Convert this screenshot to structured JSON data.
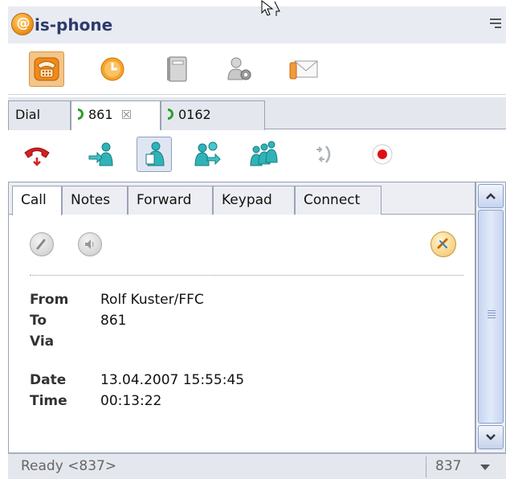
{
  "app": {
    "title": "is-phone",
    "logo_glyph": "@"
  },
  "main_toolbar": [
    {
      "name": "phone-icon",
      "active": true
    },
    {
      "name": "clock-icon",
      "active": false
    },
    {
      "name": "book-icon",
      "active": false
    },
    {
      "name": "settings-user-icon",
      "active": false
    },
    {
      "name": "mail-icon",
      "active": false
    }
  ],
  "call_tabs": {
    "dial": "Dial",
    "active_call": "861",
    "active_close": "☒",
    "other_call": "0162"
  },
  "call_toolbar": [
    {
      "name": "hangup-icon",
      "active": false
    },
    {
      "name": "transfer-icon",
      "active": false
    },
    {
      "name": "hold-icon",
      "active": true
    },
    {
      "name": "forward-user-icon",
      "active": false
    },
    {
      "name": "conference-icon",
      "active": false
    },
    {
      "name": "park-icon",
      "active": false
    },
    {
      "name": "record-icon",
      "active": false
    }
  ],
  "detail_tabs": [
    "Call",
    "Notes",
    "Forward",
    "Keypad",
    "Connect"
  ],
  "call_info": {
    "from_label": "From",
    "from_value": "Rolf Kuster/FFC",
    "to_label": "To",
    "to_value": "861",
    "via_label": "Via",
    "via_value": "",
    "date_label": "Date",
    "date_value": "13.04.2007 15:55:45",
    "time_label": "Time",
    "time_value": "00:13:22"
  },
  "status": {
    "text": "Ready <837>",
    "extension": "837"
  },
  "colors": {
    "accent": "#f3c58a",
    "titlebar": "#e9ebf3",
    "call_green": "#2aa02a",
    "hangup_red": "#d62020"
  }
}
